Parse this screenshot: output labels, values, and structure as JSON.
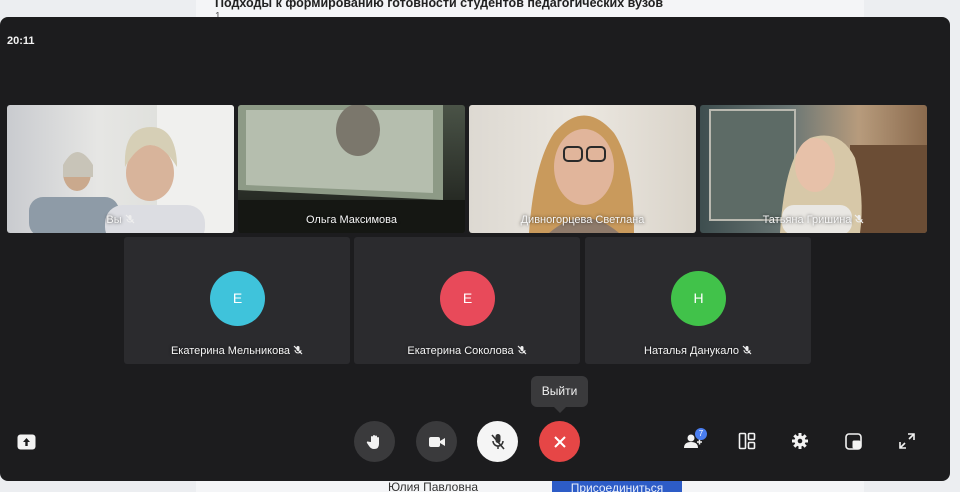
{
  "background_page": {
    "title": "Подходы к формированию готовности студентов педагогических вузов",
    "subtitle": "1",
    "bottom_name": "Юлия Павловна",
    "join_label": "Присоединиться"
  },
  "call": {
    "clock": "20:11",
    "video_tiles": [
      {
        "name": "Вы",
        "muted": true
      },
      {
        "name": "Ольга Максимова",
        "muted": false
      },
      {
        "name": "Дивногорцева Светлана",
        "muted": false
      },
      {
        "name": "Татьяна Гришина",
        "muted": true
      }
    ],
    "avatar_tiles": [
      {
        "initial": "Е",
        "name": "Екатерина Мельникова",
        "muted": true,
        "color": "#3fc3db"
      },
      {
        "initial": "Е",
        "name": "Екатерина Соколова",
        "muted": true,
        "color": "#e84a5a"
      },
      {
        "initial": "Н",
        "name": "Наталья Данукало",
        "muted": true,
        "color": "#41c24a"
      }
    ],
    "tooltip": "Выйти",
    "controls": {
      "hand_icon": "raise-hand-icon",
      "video_icon": "camera-icon",
      "mic_icon": "mic-off-icon",
      "leave_icon": "close-icon"
    },
    "participants_badge": "7"
  },
  "colors": {
    "window_bg": "#1c1c1e",
    "tile_bg": "#2b2b2e",
    "leave_red": "#e64646",
    "badge_blue": "#4a7ef0"
  }
}
